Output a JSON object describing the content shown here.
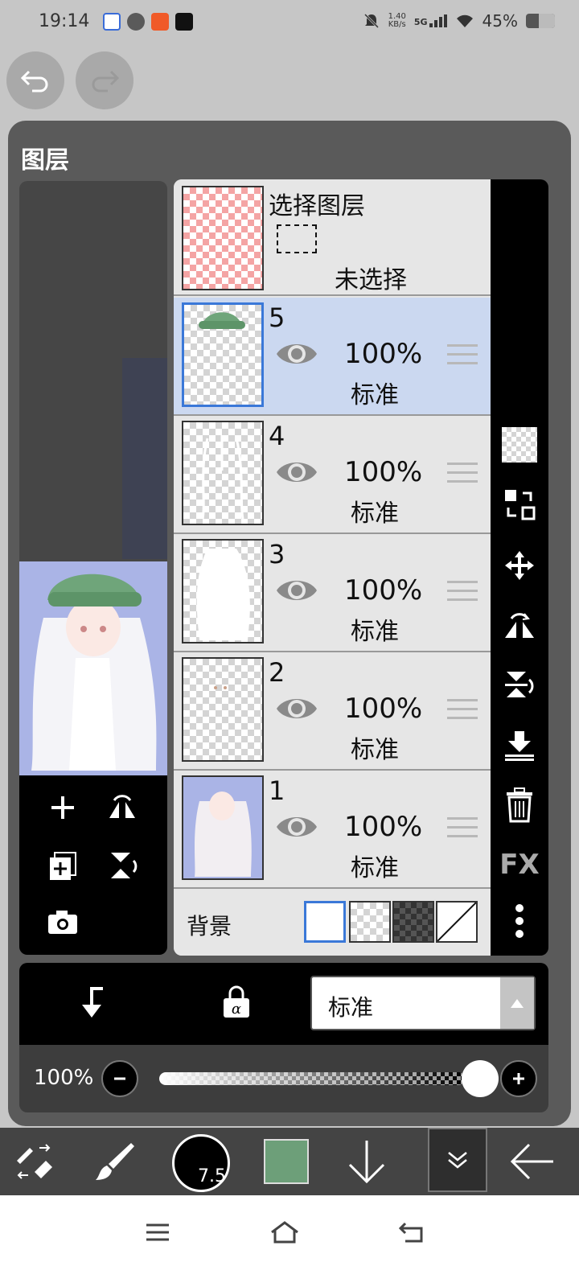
{
  "status": {
    "time": "19:14",
    "speed_value": "1.40",
    "speed_unit": "KB/s",
    "network": "5G",
    "battery": "45%"
  },
  "dialog": {
    "title": "图层"
  },
  "selection": {
    "title": "选择图层",
    "state": "未选择"
  },
  "layers": [
    {
      "number": "5",
      "opacity": "100%",
      "mode": "标准",
      "active": true
    },
    {
      "number": "4",
      "opacity": "100%",
      "mode": "标准",
      "active": false
    },
    {
      "number": "3",
      "opacity": "100%",
      "mode": "标准",
      "active": false
    },
    {
      "number": "2",
      "opacity": "100%",
      "mode": "标准",
      "active": false
    },
    {
      "number": "1",
      "opacity": "100%",
      "mode": "标准",
      "active": false
    }
  ],
  "background": {
    "label": "背景",
    "options": [
      "white",
      "light-checker",
      "dark-checker",
      "none"
    ],
    "selected": "white"
  },
  "right_tools": [
    "transparency-checker-icon",
    "transfer-icon",
    "move-icon",
    "flip-horizontal-icon",
    "flip-vertical-icon",
    "merge-down-icon",
    "trash-icon",
    "fx-icon",
    "more-icon"
  ],
  "fx_label": "FX",
  "controls": {
    "blend_mode": "标准",
    "opacity_label": "100%",
    "opacity_value": 1.0
  },
  "toolbar": {
    "brush_size": "7.5",
    "color": "#6d9f79"
  },
  "colors": {
    "accent": "#3a78d8",
    "active_layer": "#cbd8f0",
    "panel": "#5a5a5a"
  }
}
